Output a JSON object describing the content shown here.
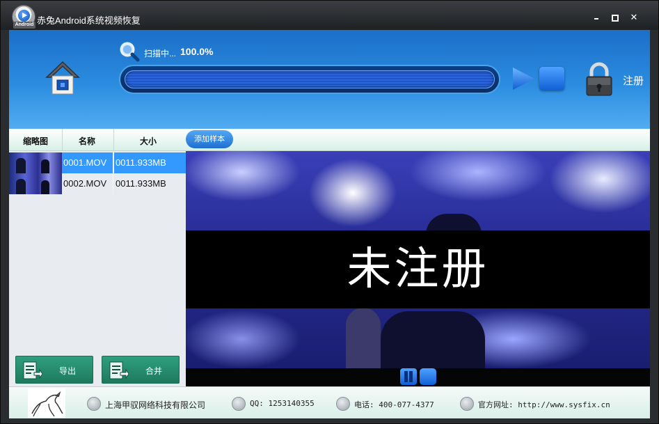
{
  "window": {
    "title": "赤兔Android系统视频恢复",
    "logo_badge": "Android"
  },
  "header": {
    "scan_label": "扫描中...",
    "scan_percent": "100.0%",
    "progress": 1.0,
    "register_label": "注册"
  },
  "file_list": {
    "columns": [
      "缩略图",
      "名称",
      "大小"
    ],
    "rows": [
      {
        "name": "0001.MOV",
        "size": "0011.933MB",
        "selected": true
      },
      {
        "name": "0002.MOV",
        "size": "0011.933MB",
        "selected": false
      }
    ],
    "export_label": "导出",
    "merge_label": "合并"
  },
  "preview": {
    "add_sample_label": "添加样本",
    "watermark": "未注册"
  },
  "footer": {
    "company": "上海甲驭网络科技有限公司",
    "qq": "QQ: 1253140355",
    "phone": "电话: 400-077-4377",
    "website": "官方网址: http://www.sysfix.cn"
  },
  "colors": {
    "header_blue": "#2b8ce0",
    "selection": "#3399ff",
    "action_green": "#1d7a5c"
  }
}
